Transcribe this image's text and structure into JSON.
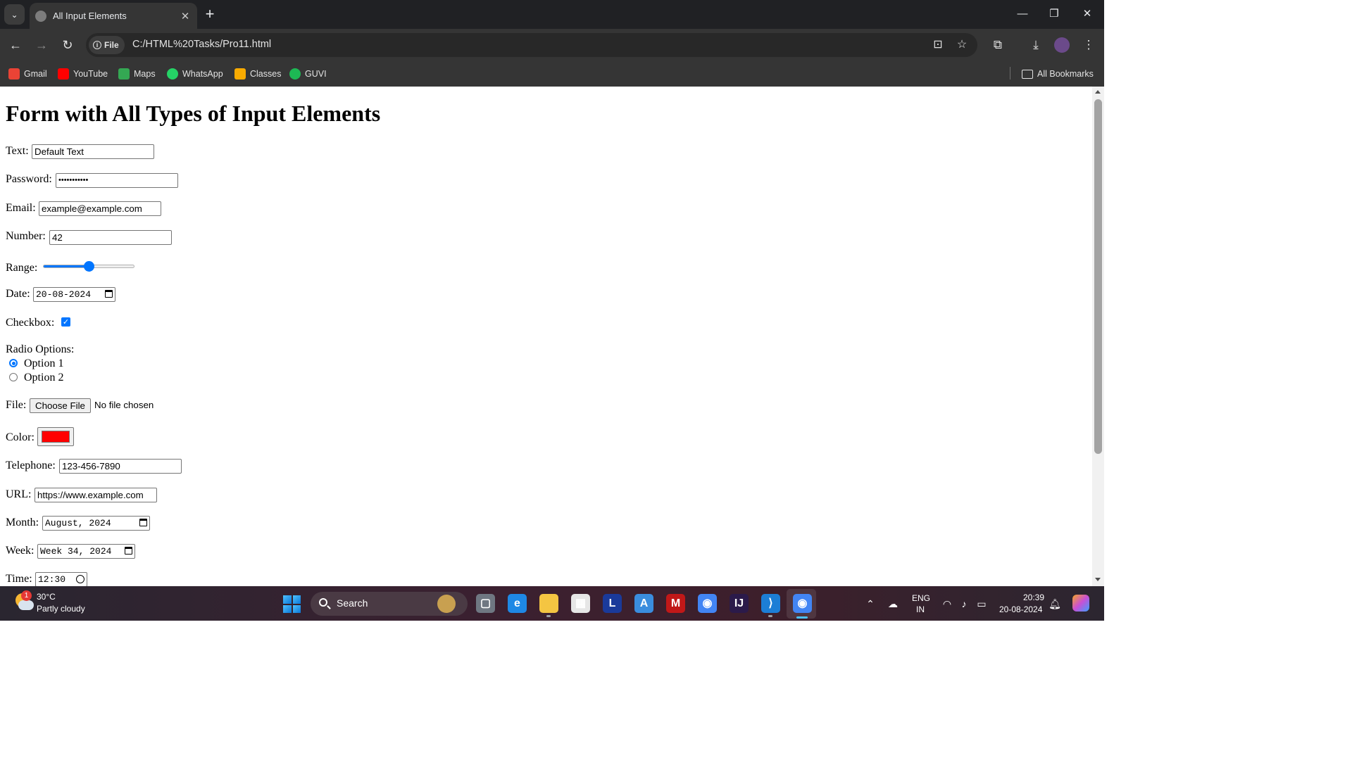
{
  "browser": {
    "tab_title": "All Input Elements",
    "omnibox": {
      "chip_label": "File",
      "url": "C:/HTML%20Tasks/Pro11.html"
    },
    "bookmarks": [
      {
        "label": "Gmail",
        "icon": "gmail-icon",
        "color": "#ea4335"
      },
      {
        "label": "YouTube",
        "icon": "youtube-icon",
        "color": "#ff0000"
      },
      {
        "label": "Maps",
        "icon": "maps-icon",
        "color": "#34a853"
      },
      {
        "label": "WhatsApp",
        "icon": "whatsapp-icon",
        "color": "#25d366"
      },
      {
        "label": "Classes",
        "icon": "classroom-icon",
        "color": "#f9ab00"
      },
      {
        "label": "GUVI",
        "icon": "guvi-icon",
        "color": "#1db954"
      }
    ],
    "all_bookmarks": "All Bookmarks"
  },
  "form": {
    "heading": "Form with All Types of Input Elements",
    "text": {
      "label": "Text:",
      "value": "Default Text"
    },
    "password": {
      "label": "Password:",
      "masked_value": "•••••••••••"
    },
    "email": {
      "label": "Email:",
      "value": "example@example.com"
    },
    "number": {
      "label": "Number:",
      "value": "42"
    },
    "range": {
      "label": "Range:",
      "value_fraction": 0.5
    },
    "date": {
      "label": "Date:",
      "value": "20-08-2024"
    },
    "checkbox": {
      "label": "Checkbox:",
      "checked": true,
      "check_glyph": "✓"
    },
    "radio": {
      "label": "Radio Options:",
      "options": [
        {
          "label": "Option 1",
          "selected": true
        },
        {
          "label": "Option 2",
          "selected": false
        }
      ]
    },
    "file": {
      "label": "File:",
      "button": "Choose File",
      "status": "No file chosen"
    },
    "color": {
      "label": "Color:",
      "value": "#ff0000"
    },
    "telephone": {
      "label": "Telephone:",
      "value": "123-456-7890"
    },
    "url": {
      "label": "URL:",
      "value": "https://www.example.com"
    },
    "month": {
      "label": "Month:",
      "value": "August, 2024"
    },
    "week": {
      "label": "Week:",
      "value": "Week 34, 2024"
    },
    "time": {
      "label": "Time:",
      "value": "12:30"
    }
  },
  "taskbar": {
    "weather": {
      "temp": "30°C",
      "desc": "Partly cloudy",
      "badge": "1"
    },
    "search_placeholder": "Search",
    "apps": [
      {
        "icon": "task-view-icon",
        "color": "#6f7782",
        "glyph": "▢"
      },
      {
        "icon": "edge-icon",
        "color": "#1e88e5",
        "glyph": "e"
      },
      {
        "icon": "file-explorer-icon",
        "color": "#f4c542",
        "glyph": ""
      },
      {
        "icon": "microsoft-store-icon",
        "color": "#e6e6e6",
        "glyph": "▦"
      },
      {
        "icon": "l-app-icon",
        "color": "#1a3a9a",
        "glyph": "L"
      },
      {
        "icon": "pen-app-icon",
        "color": "#3a8dde",
        "glyph": "A"
      },
      {
        "icon": "mcafee-icon",
        "color": "#c01818",
        "glyph": "M"
      },
      {
        "icon": "chrome-icon",
        "color": "#4285f4",
        "glyph": "◉"
      },
      {
        "icon": "intellij-icon",
        "color": "#2b1a4a",
        "glyph": "IJ"
      },
      {
        "icon": "vscode-icon",
        "color": "#1c7ed6",
        "glyph": "⟩"
      },
      {
        "icon": "chrome-profile-icon",
        "color": "#4285f4",
        "glyph": "◉"
      }
    ],
    "tray": {
      "lang1": "ENG",
      "lang2": "IN",
      "time": "20:39",
      "date": "20-08-2024"
    }
  }
}
